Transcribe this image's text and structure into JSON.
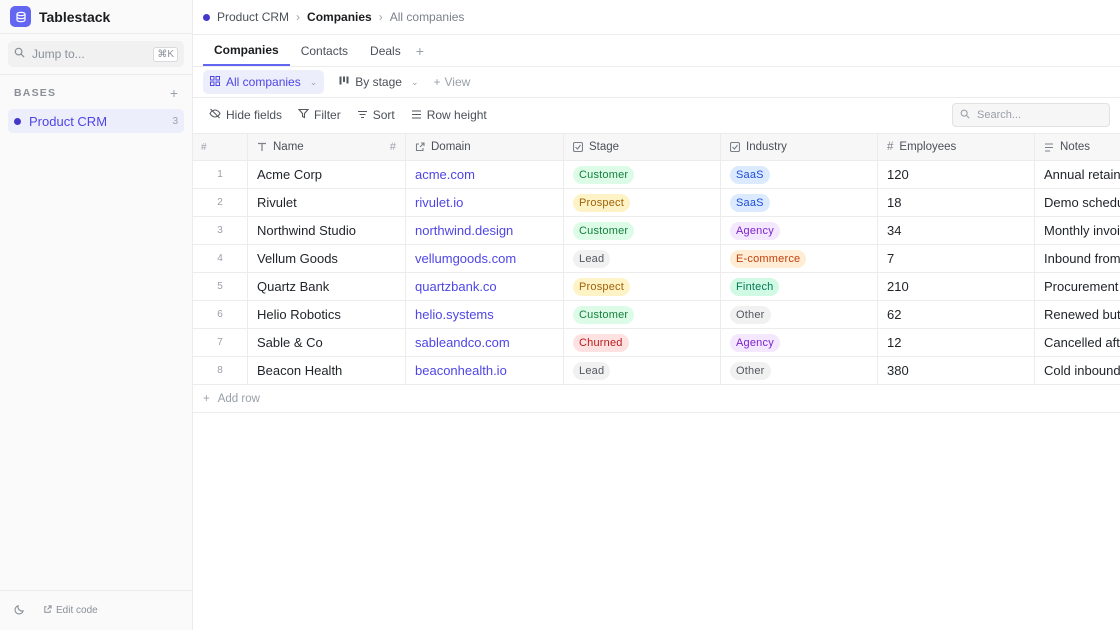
{
  "app": {
    "name": "Tablestack",
    "logo_color": "#6366f1"
  },
  "sidebar": {
    "jump_placeholder": "Jump to...",
    "jump_shortcut": "⌘K",
    "section_title": "BASES",
    "bases": [
      {
        "label": "Product CRM",
        "count": "3",
        "dot_color": "#4338ca"
      }
    ],
    "footer": {
      "edit_label": "Edit code"
    }
  },
  "breadcrumb": {
    "base": "Product CRM",
    "table": "Companies",
    "view": "All companies"
  },
  "tabs": [
    "Companies",
    "Contacts",
    "Deals"
  ],
  "views": {
    "active": "All companies",
    "second": "By stage",
    "add": "View"
  },
  "toolbar": {
    "hide_fields": "Hide fields",
    "filter": "Filter",
    "sort": "Sort",
    "row_height": "Row height",
    "search_placeholder": "Search..."
  },
  "table": {
    "columns": {
      "index": "#",
      "name": "Name",
      "domain": "Domain",
      "stage": "Stage",
      "industry": "Industry",
      "employees": "Employees",
      "notes": "Notes"
    },
    "rows": [
      {
        "n": "1",
        "name": "Acme Corp",
        "domain": "acme.com",
        "stage": "Customer",
        "industry": "SaaS",
        "employees": "120",
        "notes": "Annual retainer"
      },
      {
        "n": "2",
        "name": "Rivulet",
        "domain": "rivulet.io",
        "stage": "Prospect",
        "industry": "SaaS",
        "employees": "18",
        "notes": "Demo scheduled"
      },
      {
        "n": "3",
        "name": "Northwind Studio",
        "domain": "northwind.design",
        "stage": "Customer",
        "industry": "Agency",
        "employees": "34",
        "notes": "Monthly invoice"
      },
      {
        "n": "4",
        "name": "Vellum Goods",
        "domain": "vellumgoods.com",
        "stage": "Lead",
        "industry": "E-commerce",
        "employees": "7",
        "notes": "Inbound from"
      },
      {
        "n": "5",
        "name": "Quartz Bank",
        "domain": "quartzbank.co",
        "stage": "Prospect",
        "industry": "Fintech",
        "employees": "210",
        "notes": "Procurement -"
      },
      {
        "n": "6",
        "name": "Helio Robotics",
        "domain": "helio.systems",
        "stage": "Customer",
        "industry": "Other",
        "employees": "62",
        "notes": "Renewed but p"
      },
      {
        "n": "7",
        "name": "Sable & Co",
        "domain": "sableandco.com",
        "stage": "Churned",
        "industry": "Agency",
        "employees": "12",
        "notes": "Cancelled after"
      },
      {
        "n": "8",
        "name": "Beacon Health",
        "domain": "beaconhealth.io",
        "stage": "Lead",
        "industry": "Other",
        "employees": "380",
        "notes": "Cold inbound."
      }
    ],
    "add_row": "Add row"
  },
  "badge_colors": {
    "Customer": {
      "bg": "#dcfce7",
      "fg": "#15803d"
    },
    "Prospect": {
      "bg": "#fef3c7",
      "fg": "#a16207"
    },
    "Lead": {
      "bg": "#f1f1f2",
      "fg": "#52565d"
    },
    "Churned": {
      "bg": "#fee2e2",
      "fg": "#b91c1c"
    },
    "SaaS": {
      "bg": "#dbeafe",
      "fg": "#1d4ed8"
    },
    "Agency": {
      "bg": "#f3e8ff",
      "fg": "#7e22ce"
    },
    "E-commerce": {
      "bg": "#ffedd5",
      "fg": "#c2410c"
    },
    "Fintech": {
      "bg": "#d1fae5",
      "fg": "#047857"
    },
    "Other": {
      "bg": "#f1f1f2",
      "fg": "#52565d"
    }
  }
}
